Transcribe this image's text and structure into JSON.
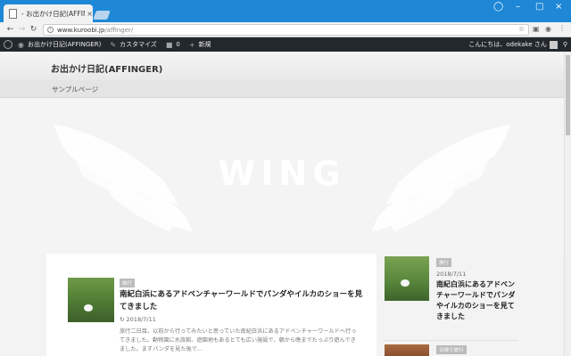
{
  "browser": {
    "tab_title": "- お出かけ日記(AFFINGER)",
    "tab_close": "×",
    "url_domain": "www.kuroobi.jp",
    "url_path": "/affinger/",
    "window_controls": [
      "–",
      "□",
      "×"
    ]
  },
  "admin_bar": {
    "site_name": "お出かけ日記(AFFINGER)",
    "customize": "カスタマイズ",
    "comments_count": "0",
    "new_label": "新規",
    "greeting": "こんにちは、odekake さん"
  },
  "site": {
    "title": "お出かけ日記(AFFINGER)",
    "nav_items": [
      "サンプルページ"
    ]
  },
  "hero": {
    "logo_text": "WING"
  },
  "main_post": {
    "category": "旅行",
    "title": "南紀白浜にあるアドベンチャーワールドでパンダやイルカのショーを見てきました",
    "date": "2018/7/11",
    "excerpt": "旅行二日目。以前から行ってみたいと思っていた南紀白浜にあるアドベンチャーワールドへ行ってきました。動物園に水族館、遊園地もあるとても広い施設で、朝から晩までたっぷり遊んできました。まずパンダを見た後で..."
  },
  "sidebar_post": {
    "category": "旅行",
    "date": "2018/7/11",
    "title": "南紀白浜にあるアドベンチャーワールドでパンダやイルカのショーを見てきました",
    "next_category": "日帰り旅行"
  },
  "colors": {
    "chrome_blue": "#1e88d6",
    "admin_bar": "#23282d",
    "badge": "#bbbbbb"
  }
}
